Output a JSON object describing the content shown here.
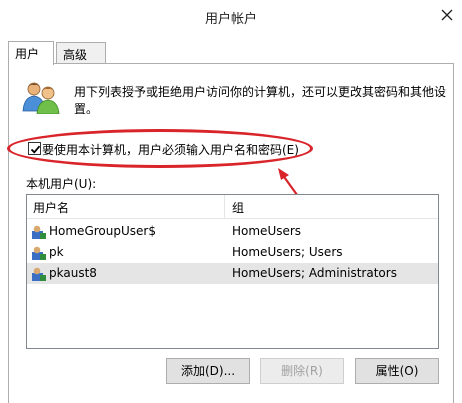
{
  "window": {
    "title": "用户帐户"
  },
  "tabs": [
    {
      "label": "用户",
      "active": true
    },
    {
      "label": "高级",
      "active": false
    }
  ],
  "description": "用下列表授予或拒绝用户访问你的计算机，还可以更改其密码和其他设置。",
  "require_login_checkbox": {
    "label": "要使用本计算机，用户必须输入用户名和密码(E)",
    "checked": true
  },
  "annotation": {
    "highlight_color": "#d9242a"
  },
  "local_users_label": "本机用户(U):",
  "list": {
    "columns": [
      "用户名",
      "组"
    ],
    "rows": [
      {
        "name": "HomeGroupUser$",
        "group": "HomeUsers",
        "selected": false
      },
      {
        "name": "pk",
        "group": "HomeUsers; Users",
        "selected": false
      },
      {
        "name": "pkaust8",
        "group": "HomeUsers; Administrators",
        "selected": true
      }
    ]
  },
  "buttons": {
    "add": "添加(D)...",
    "remove": "删除(R)",
    "properties": "属性(O)"
  }
}
